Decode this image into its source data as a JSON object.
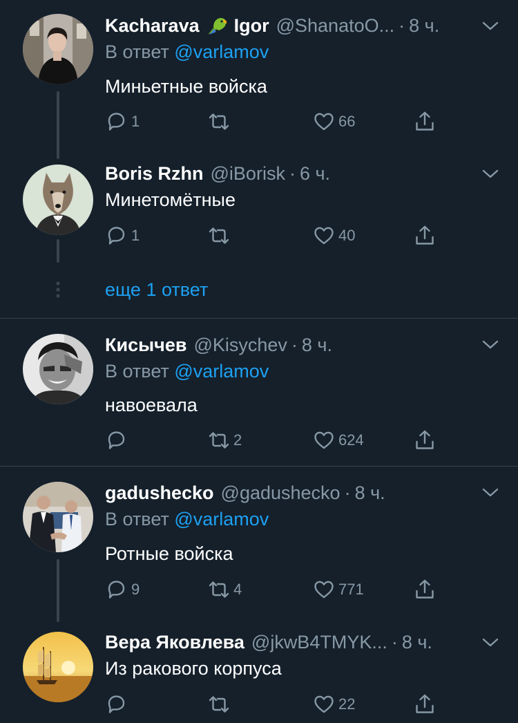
{
  "colors": {
    "background": "#15202b",
    "secondary_text": "#8899a6",
    "accent": "#1da1f2",
    "divider": "#38444d"
  },
  "tweets": [
    {
      "name": "Kacharava",
      "name_after_emoji": "Igor",
      "emoji_icon": "parrot-icon",
      "handle": "@ShanatoO...",
      "separator": "·",
      "time": "8 ч.",
      "reply_prefix": "В ответ",
      "reply_mention": "@varlamov",
      "text": "Миньетные войска",
      "reply_count": "1",
      "retweet_count": "",
      "like_count": "66"
    },
    {
      "name": "Boris Rzhn",
      "handle": "@iBorisk",
      "separator": "·",
      "time": "6 ч.",
      "text": "Минетомётные",
      "reply_count": "1",
      "retweet_count": "",
      "like_count": "40"
    },
    {
      "name": "Кисычев",
      "handle": "@Kisychev",
      "separator": "·",
      "time": "8 ч.",
      "reply_prefix": "В ответ",
      "reply_mention": "@varlamov",
      "text": "навоевала",
      "reply_count": "",
      "retweet_count": "2",
      "like_count": "624"
    },
    {
      "name": "gadushecko",
      "handle": "@gadushecko",
      "separator": "·",
      "time": "8 ч.",
      "reply_prefix": "В ответ",
      "reply_mention": "@varlamov",
      "text": "Ротные войска",
      "reply_count": "9",
      "retweet_count": "4",
      "like_count": "771"
    },
    {
      "name": "Вера Яковлева",
      "handle": "@jkwB4TMYK...",
      "separator": "·",
      "time": "8 ч.",
      "text": "Из ракового корпуса",
      "reply_count": "",
      "retweet_count": "",
      "like_count": "22"
    }
  ],
  "show_more": "еще 1 ответ"
}
